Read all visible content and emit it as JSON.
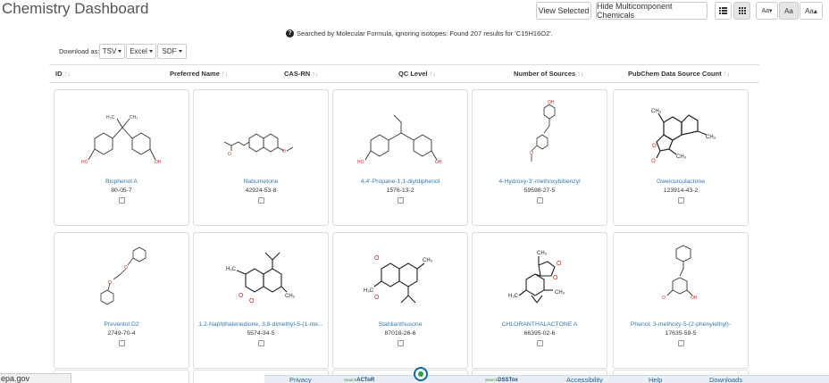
{
  "app": {
    "title": "Chemistry Dashboard"
  },
  "toolbar": {
    "view_selected": "View Selected",
    "hide_multicomponent": "Hide Multicomponent Chemicals",
    "font_small": "Aa▾",
    "font_medium": "Aa",
    "font_large": "Aa▴"
  },
  "search": {
    "message": "Searched by Molecular Formula, ignoring isotopes: Found 207 results for 'C15H16O2'."
  },
  "download": {
    "label": "Download as:",
    "formats": [
      "TSV",
      "Excel",
      "SDF"
    ]
  },
  "columns": [
    "ID",
    "Preferred Name",
    "CAS-RN",
    "QC Level",
    "Number of Sources",
    "PubChem Data Source Count"
  ],
  "results": [
    {
      "name": "Bisphenol A",
      "casrn": "80-05-7",
      "structure": "bisphenol-a"
    },
    {
      "name": "Nabumetone",
      "casrn": "42924-53-8",
      "structure": "nabumetone"
    },
    {
      "name": "4,4'-Propane-1,1-diyldiphenol",
      "casrn": "1576-13-2",
      "structure": "propane-diyldiphenol"
    },
    {
      "name": "4-Hydroxy-3'-methoxybibenzyl",
      "casrn": "59598-27-5",
      "structure": "hydroxy-methoxybibenzyl"
    },
    {
      "name": "Gweicurculactone",
      "casrn": "123914-43-2",
      "structure": "gweicurculactone"
    },
    {
      "name": "Preventol D2",
      "casrn": "2749-70-4",
      "structure": "preventol-d2"
    },
    {
      "name": "1,2-Naphthalenedione, 3,8-dimethyl-5-(1-me...",
      "casrn": "5574-34-5",
      "structure": "naphthalenedione"
    },
    {
      "name": "Stahlianthusone",
      "casrn": "87018-26-6",
      "structure": "stahlianthusone"
    },
    {
      "name": "CHLORANTHALACTONE A",
      "casrn": "66395-02-6",
      "structure": "chloranthalactone"
    },
    {
      "name": "Phenol, 3-methoxy-5-(2-phenylethyl)-",
      "casrn": "17635-59-5",
      "structure": "methoxy-phenylethyl-phenol"
    }
  ],
  "status_url": "epa.gov",
  "footer": {
    "links": [
      "Privacy",
      "Accessibility",
      "Help",
      "Downloads"
    ],
    "actor_small": "Search",
    "actor": "ACToR",
    "dsstox_small": "Search",
    "dsstox": "DSSTox"
  },
  "colors": {
    "link": "#337ab7",
    "oxygen": "#e02020",
    "bond": "#333333"
  }
}
